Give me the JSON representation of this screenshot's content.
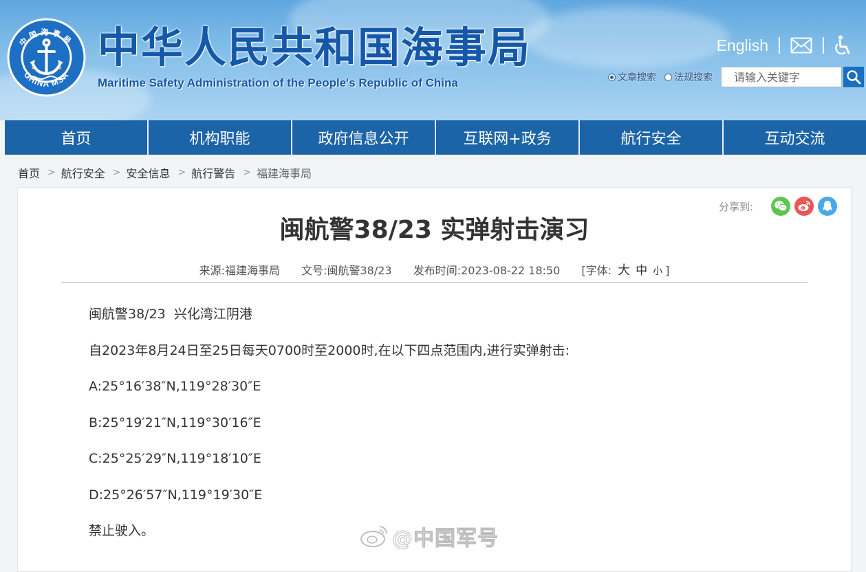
{
  "header": {
    "title_cn": "中华人民共和国海事局",
    "title_en": "Maritime Safety Administration of the People's Republic of China",
    "logo_text_top": "中国海事局",
    "logo_text_bottom": "CHINA MSA",
    "english_link": "English",
    "mail_icon": "mail-icon",
    "accessibility_icon": "accessibility-icon",
    "search": {
      "option_article": "文章搜索",
      "option_regulation": "法规搜索",
      "selected": "文章搜索",
      "placeholder": "请输入关键字",
      "value": ""
    }
  },
  "nav": {
    "items": [
      "首页",
      "机构职能",
      "政府信息公开",
      "互联网+政务",
      "航行安全",
      "互动交流"
    ]
  },
  "breadcrumb": {
    "items": [
      "首页",
      "航行安全",
      "安全信息",
      "航行警告",
      "福建海事局"
    ]
  },
  "article": {
    "share_label": "分享到:",
    "share_icons": [
      "wechat-icon",
      "weibo-icon",
      "qzone-icon"
    ],
    "title": "闽航警38/23 实弹射击演习",
    "meta": {
      "source": "来源:福建海事局",
      "doc_no": "文号:闽航警38/23",
      "published": "发布时间:2023-08-22 18:50",
      "font_label": "[字体:",
      "font_big": "大",
      "font_mid": "中",
      "font_small": "小",
      "font_close": "]"
    },
    "paragraphs": [
      "闽航警38/23  兴化湾江阴港",
      "自2023年8月24日至25日每天0700时至2000时,在以下四点范围内,进行实弹射击:",
      "A:25°16′38″N,119°28′30″E",
      "B:25°19′21″N,119°30′16″E",
      "C:25°25′29″N,119°18′10″E",
      "D:25°26′57″N,119°19′30″E",
      "禁止驶入。"
    ]
  },
  "watermark": {
    "text": "@中国军号"
  },
  "colors": {
    "nav_bg": "#1b64a8",
    "title_blue": "#1558a8",
    "wechat": "#5ec650",
    "weibo": "#e8565a",
    "qzone": "#4aa8ea"
  }
}
